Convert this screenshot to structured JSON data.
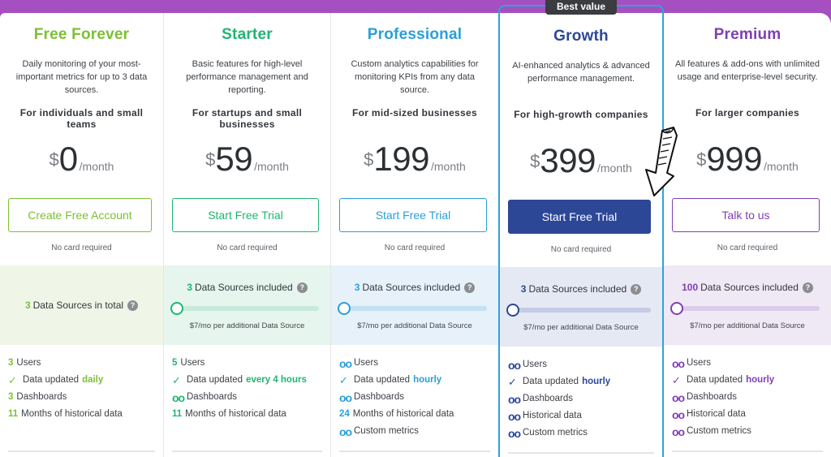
{
  "badge": "Best value",
  "plans": [
    {
      "name": "Free Forever",
      "color": "#7cc034",
      "description": "Daily monitoring of your most-important metrics for up to 3 data sources.",
      "audience": "For individuals and small teams",
      "currency": "$",
      "price": "0",
      "period": "/month",
      "cta": "Create Free Account",
      "note": "No card required",
      "data_sources": {
        "count": "3",
        "label": "Data Sources in total",
        "help_icon": "question-icon",
        "bg": "#eff6e8"
      },
      "features": [
        {
          "icon": "number",
          "value": "3",
          "label": "Users"
        },
        {
          "icon": "check-icon",
          "label": "Data updated",
          "highlight": "daily"
        },
        {
          "icon": "number",
          "value": "3",
          "label": "Dashboards"
        },
        {
          "icon": "number",
          "value": "11",
          "label": "Months of historical data"
        }
      ]
    },
    {
      "name": "Starter",
      "color": "#1fb573",
      "description": "Basic features for high-level performance management and reporting.",
      "audience": "For startups and small businesses",
      "currency": "$",
      "price": "59",
      "period": "/month",
      "cta": "Start Free Trial",
      "note": "No card required",
      "data_sources": {
        "count": "3",
        "label": "Data Sources included",
        "help_icon": "question-icon",
        "slider_value": 0,
        "extra": "$7/mo per additional Data Source",
        "bg": "#e6f5ee",
        "track": "#c7eadb"
      },
      "features": [
        {
          "icon": "number",
          "value": "5",
          "label": "Users"
        },
        {
          "icon": "check-icon",
          "label": "Data updated",
          "highlight": "every 4 hours"
        },
        {
          "icon": "infinity-icon",
          "label": "Dashboards"
        },
        {
          "icon": "number",
          "value": "11",
          "label": "Months of historical data"
        }
      ]
    },
    {
      "name": "Professional",
      "color": "#2a9fd8",
      "description": "Custom analytics capabilities for monitoring KPIs from any data source.",
      "audience": "For mid-sized businesses",
      "currency": "$",
      "price": "199",
      "period": "/month",
      "cta": "Start Free Trial",
      "note": "No card required",
      "data_sources": {
        "count": "3",
        "label": "Data Sources included",
        "help_icon": "question-icon",
        "slider_value": 0,
        "extra": "$7/mo per additional Data Source",
        "bg": "#e6f1fa",
        "track": "#c4e1f2"
      },
      "features": [
        {
          "icon": "infinity-icon",
          "label": "Users"
        },
        {
          "icon": "check-icon",
          "label": "Data updated",
          "highlight": "hourly"
        },
        {
          "icon": "infinity-icon",
          "label": "Dashboards"
        },
        {
          "icon": "number",
          "value": "24",
          "label": "Months of historical data"
        },
        {
          "icon": "infinity-icon",
          "label": "Custom metrics"
        }
      ]
    },
    {
      "name": "Growth",
      "color": "#2d4797",
      "description": "AI-enhanced analytics & advanced performance management.",
      "audience": "For high-growth companies",
      "currency": "$",
      "price": "399",
      "period": "/month",
      "cta": "Start Free Trial",
      "note": "No card required",
      "featured": true,
      "data_sources": {
        "count": "3",
        "label": "Data Sources included",
        "help_icon": "question-icon",
        "slider_value": 0,
        "extra": "$7/mo per additional Data Source",
        "bg": "#e5e9f4",
        "track": "#c4cbe3"
      },
      "features": [
        {
          "icon": "infinity-icon",
          "label": "Users"
        },
        {
          "icon": "check-icon",
          "label": "Data updated",
          "highlight": "hourly"
        },
        {
          "icon": "infinity-icon",
          "label": "Dashboards"
        },
        {
          "icon": "infinity-icon",
          "label": "Historical data"
        },
        {
          "icon": "infinity-icon",
          "label": "Custom metrics"
        }
      ]
    },
    {
      "name": "Premium",
      "color": "#7f3fb4",
      "description": "All features & add-ons with unlimited usage and enterprise-level security.",
      "audience": "For larger companies",
      "currency": "$",
      "price": "999",
      "period": "/month",
      "cta": "Talk to us",
      "note": "No card required",
      "data_sources": {
        "count": "100",
        "label": "Data Sources included",
        "help_icon": "question-icon",
        "slider_value": 0,
        "extra": "$7/mo per additional Data Source",
        "bg": "#efe8f5",
        "track": "#dccbea"
      },
      "features": [
        {
          "icon": "infinity-icon",
          "label": "Users"
        },
        {
          "icon": "check-icon",
          "label": "Data updated",
          "highlight": "hourly"
        },
        {
          "icon": "infinity-icon",
          "label": "Dashboards"
        },
        {
          "icon": "infinity-icon",
          "label": "Historical data"
        },
        {
          "icon": "infinity-icon",
          "label": "Custom metrics"
        }
      ]
    }
  ],
  "annotation": {
    "icon": "hand-drawn-arrow-icon"
  }
}
